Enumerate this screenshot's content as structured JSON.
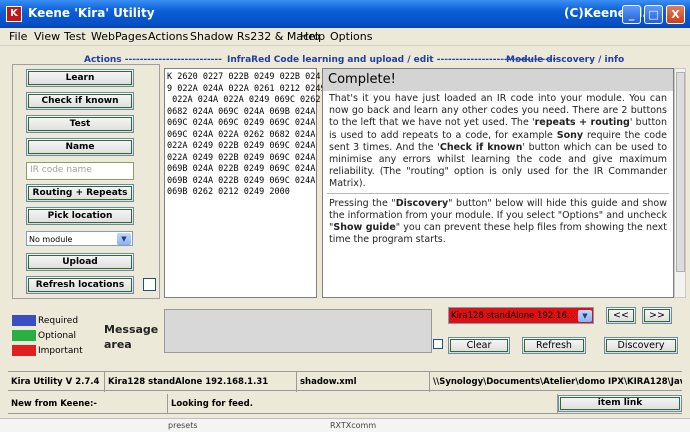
{
  "window": {
    "title": "Keene 'Kira' Utility",
    "title_right": "(C)Keene El...",
    "icon_glyph": "K",
    "controls": [
      "_",
      "□",
      "X"
    ]
  },
  "menu": [
    "File",
    "View",
    "Test",
    "WebPages",
    "Actions",
    "Shadow Rs232 & Macro",
    "Help",
    "Options"
  ],
  "sections": {
    "actions": "Actions --------------------------",
    "infrared": "InfraRed Code learning and upload / edit ---------------------------------",
    "module": "Module discovery / info"
  },
  "left_buttons": {
    "learn": "Learn",
    "check": "Check if known",
    "test": "Test",
    "name": "Name",
    "routing": "Routing + Repeats",
    "pick": "Pick location",
    "upload": "Upload",
    "refresh_loc": "Refresh locations"
  },
  "ir_code_name": {
    "placeholder": "IR code name"
  },
  "module_select": {
    "value": "No module"
  },
  "ir_code": "K 2620 0227 022B 0249 022B 024\n9 022A 024A 022A 0261 0212 0249\n 022A 024A 022A 0249 069C 0262\n0682 024A 069C 024A 069B 024A\n069C 024A 069C 0249 069C 024A\n069C 024A 022A 0262 0682 024A\n022A 0249 022B 0249 069C 024A\n022A 0249 022B 0249 069C 024A\n069B 024A 022B 0249 069C 024A\n069B 024A 022B 0249 069C 024A\n069B 0262 0212 0249 2000",
  "help": {
    "heading": "Complete!",
    "p1_a": "That's it you have just loaded an IR code into your module. You can now go back and learn any other codes you need. There are 2 buttons to the left that we have not yet used. The '",
    "p1_b": "repeats + routing",
    "p1_c": "' button is used to add repeats to a code, for example ",
    "p1_d": "Sony",
    "p1_e": " require the code sent 3 times. And the '",
    "p1_f": "Check if known",
    "p1_g": "' button which can be used to minimise any errors whilst learning the code and give maximum reliability. (The \"routing\" option is only used for the IR Commander Matrix).",
    "p2_a": "Pressing the \"",
    "p2_b": "Discovery",
    "p2_c": "\" button\" below will hide this guide and show the information from your module. If you select \"Options\" and uncheck \"",
    "p2_d": "Show guide",
    "p2_e": "\" you can prevent these help files from showing the next time the program starts."
  },
  "legend": [
    {
      "label": "Required",
      "color": "#3a4ec4"
    },
    {
      "label": "Optional",
      "color": "#28b040"
    },
    {
      "label": "Important",
      "color": "#e02020"
    }
  ],
  "message": {
    "label_1": "Message",
    "label_2": "area"
  },
  "device_select": {
    "value": "Kira128 standAlone 192.16...",
    "color": "#e01010"
  },
  "nav": {
    "prev": "<<",
    "next": ">>"
  },
  "action_buttons": {
    "clear": "Clear",
    "refresh": "Refresh",
    "discovery": "Discovery"
  },
  "status1": {
    "version": "Kira Utility V 2.7.4",
    "device": "Kira128 standAlone 192.168.1.31",
    "file": "shadow.xml",
    "path": "\\\\Synology\\Documents\\Atelier\\domo IPX\\KIRA128\\Java ..."
  },
  "status2": {
    "news": "New from Keene:-",
    "feed": "Looking for feed.",
    "item_link": "item link"
  },
  "taskbar": [
    "presets",
    "RXTXcomm"
  ]
}
